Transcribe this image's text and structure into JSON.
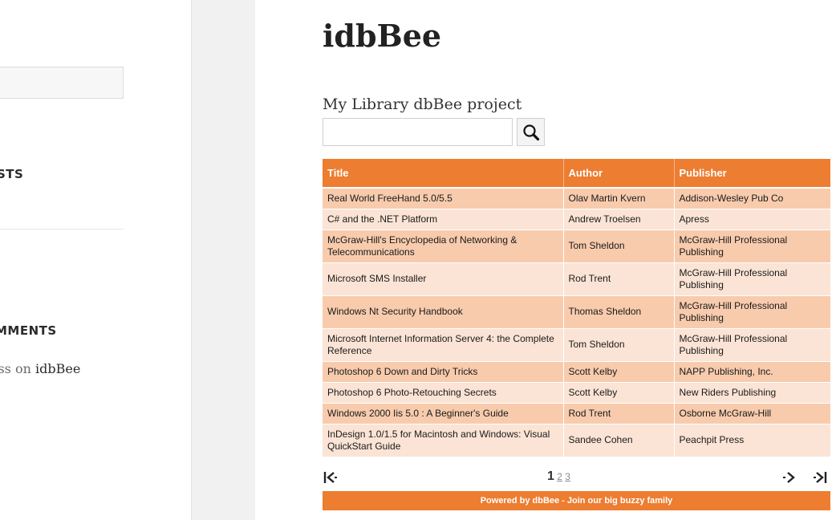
{
  "sidebar": {
    "heading_posts": "STS",
    "heading_comments": "MMENTS",
    "comment": {
      "author": "ess",
      "connector": "on",
      "post": "idbBee"
    }
  },
  "main": {
    "title": "idbBee",
    "project_title": "My Library dbBee project",
    "search": {
      "value": "",
      "placeholder": ""
    }
  },
  "table": {
    "columns": [
      "Title",
      "Author",
      "Publisher"
    ],
    "rows": [
      {
        "title": "Real World FreeHand 5.0/5.5",
        "author": "Olav Martin Kvern",
        "publisher": "Addison-Wesley Pub Co"
      },
      {
        "title": "C# and the .NET Platform",
        "author": "Andrew Troelsen",
        "publisher": "Apress"
      },
      {
        "title": "McGraw-Hill's Encyclopedia of Networking & Telecommunications",
        "author": "Tom Sheldon",
        "publisher": "McGraw-Hill Professional Publishing"
      },
      {
        "title": "Microsoft SMS Installer",
        "author": "Rod Trent",
        "publisher": "McGraw-Hill Professional Publishing"
      },
      {
        "title": "Windows Nt Security Handbook",
        "author": "Thomas Sheldon",
        "publisher": "McGraw-Hill Professional Publishing"
      },
      {
        "title": "Microsoft Internet Information Server 4: the Complete Reference",
        "author": "Tom Sheldon",
        "publisher": "McGraw-Hill Professional Publishing"
      },
      {
        "title": "Photoshop 6 Down and Dirty Tricks",
        "author": "Scott Kelby",
        "publisher": "NAPP Publishing, Inc."
      },
      {
        "title": "Photoshop 6 Photo-Retouching Secrets",
        "author": "Scott Kelby",
        "publisher": "New Riders Publishing"
      },
      {
        "title": "Windows 2000 Iis 5.0 : A Beginner's Guide",
        "author": "Rod Trent",
        "publisher": "Osborne McGraw-Hill"
      },
      {
        "title": "InDesign 1.0/1.5 for Macintosh and Windows: Visual QuickStart Guide",
        "author": "Sandee Cohen",
        "publisher": "Peachpit Press"
      }
    ]
  },
  "pagination": {
    "current": "1",
    "other_pages": [
      "2",
      "3"
    ]
  },
  "icons": {
    "search": "magnifier-icon",
    "first": "first-page-icon",
    "next": "next-page-icon",
    "last": "last-page-icon"
  },
  "footer": {
    "text": "Powered by dbBee - Join our big buzzy family"
  },
  "colors": {
    "accent": "#ed7d31",
    "row_odd": "#f8cbad",
    "row_even": "#fbe4d5"
  }
}
